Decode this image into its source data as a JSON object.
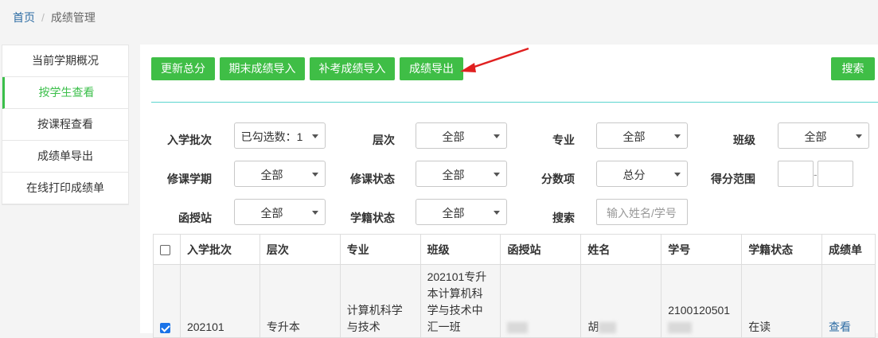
{
  "breadcrumb": {
    "home": "首页",
    "separator": "/",
    "current": "成绩管理"
  },
  "sidebar": {
    "items": [
      {
        "label": "当前学期概况"
      },
      {
        "label": "按学生查看"
      },
      {
        "label": "按课程查看"
      },
      {
        "label": "成绩单导出"
      },
      {
        "label": "在线打印成绩单"
      }
    ]
  },
  "toolbar": {
    "update_total": "更新总分",
    "final_import": "期末成绩导入",
    "makeup_import": "补考成绩导入",
    "export": "成绩导出",
    "search": "搜索"
  },
  "filters": {
    "enroll_batch": {
      "label": "入学批次",
      "value": "已勾选数：1"
    },
    "level": {
      "label": "层次",
      "value": "全部"
    },
    "major": {
      "label": "专业",
      "value": "全部"
    },
    "class": {
      "label": "班级",
      "value": "全部"
    },
    "semester": {
      "label": "修课学期",
      "value": "全部"
    },
    "course_status": {
      "label": "修课状态",
      "value": "全部"
    },
    "score_item": {
      "label": "分数项",
      "value": "总分"
    },
    "score_range": {
      "label": "得分范围",
      "separator": "-"
    },
    "station": {
      "label": "函授站",
      "value": "全部"
    },
    "enroll_status": {
      "label": "学籍状态",
      "value": "全部"
    },
    "search": {
      "label": "搜索",
      "placeholder": "输入姓名/学号"
    }
  },
  "table": {
    "headers": [
      "入学批次",
      "层次",
      "专业",
      "班级",
      "函授站",
      "姓名",
      "学号",
      "学籍状态",
      "成绩单"
    ],
    "rows": [
      {
        "checked": true,
        "batch": "202101",
        "level": "专升本",
        "major": "计算机科学与技术",
        "class": "202101专升本计算机科学与技术中汇一班",
        "name_visible": "胡",
        "student_id_visible": "2100120501",
        "status": "在读",
        "action": "查看"
      }
    ]
  },
  "colors": {
    "accent_green": "#3fbe46",
    "link_blue": "#2e6da4",
    "divider_teal": "#5bd5cf",
    "arrow_red": "#e02020"
  }
}
